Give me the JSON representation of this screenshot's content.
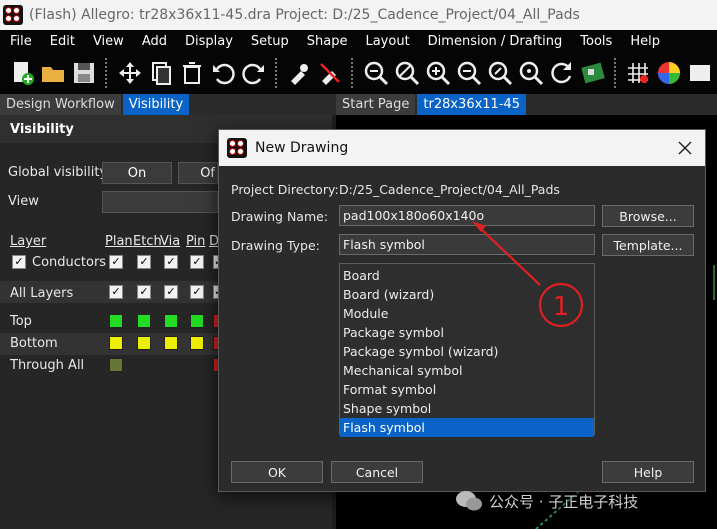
{
  "window": {
    "title": "(Flash) Allegro: tr28x36x11-45.dra  Project: D:/25_Cadence_Project/04_All_Pads"
  },
  "menu": [
    "File",
    "Edit",
    "View",
    "Add",
    "Display",
    "Setup",
    "Shape",
    "Layout",
    "Dimension / Drafting",
    "Tools",
    "Help"
  ],
  "toolbar_icons": [
    "new-file-icon",
    "open-folder-icon",
    "save-icon",
    "move-icon",
    "copy-icon",
    "delete-icon",
    "undo-icon",
    "redo-icon",
    "pin-icon",
    "unpin-icon",
    "zoom-fit-icon",
    "zoom-in-icon",
    "zoom-in-plus-icon",
    "zoom-out-icon",
    "zoom-previous-icon",
    "zoom-center-icon",
    "refresh-icon",
    "board-icon",
    "grid-icon",
    "color-icon",
    "layer-icon"
  ],
  "left_tabs": [
    {
      "label": "Design Workflow",
      "active": false
    },
    {
      "label": "Visibility",
      "active": true
    }
  ],
  "canvas_tabs": [
    {
      "label": "Start Page",
      "active": false
    },
    {
      "label": "tr28x36x11-45",
      "active": true
    }
  ],
  "panel": {
    "title": "Visibility",
    "global_visibility_label": "Global visibility",
    "on_label": "On",
    "off_label_partial": "Of",
    "view_label": "View",
    "layer_header": "Layer",
    "columns": [
      "Plan",
      "Etch",
      "Via",
      "Pin",
      "D"
    ],
    "conductors_label": "Conductors",
    "all_layers_label": "All Layers",
    "layers": [
      {
        "name": "Top",
        "colors": [
          "#22dd22",
          "#22dd22",
          "#22dd22",
          "#22dd22",
          "#dd2222"
        ]
      },
      {
        "name": "Bottom",
        "colors": [
          "#eeee00",
          "#eeee00",
          "#eeee00",
          "#eeee00",
          "#dd2222"
        ]
      },
      {
        "name": "Through All",
        "colors": [
          "#667733",
          "",
          "",
          "",
          "#dd2222"
        ]
      }
    ]
  },
  "dialog": {
    "title": "New Drawing",
    "project_directory_label": "Project Directory:",
    "project_directory_value": "D:/25_Cadence_Project/04_All_Pads",
    "drawing_name_label": "Drawing Name:",
    "drawing_name_value": "pad100x180o60x140o",
    "browse_label": "Browse...",
    "drawing_type_label": "Drawing Type:",
    "drawing_type_value": "Flash symbol",
    "template_label": "Template...",
    "types": [
      "Board",
      "Board (wizard)",
      "Module",
      "Package symbol",
      "Package symbol (wizard)",
      "Mechanical symbol",
      "Format symbol",
      "Shape symbol",
      "Flash symbol"
    ],
    "selected_type": "Flash symbol",
    "ok_label": "OK",
    "cancel_label": "Cancel",
    "help_label": "Help"
  },
  "annotation": {
    "number": "1",
    "color": "#e02020"
  },
  "watermark": {
    "text": "公众号 · 子正电子科技"
  }
}
